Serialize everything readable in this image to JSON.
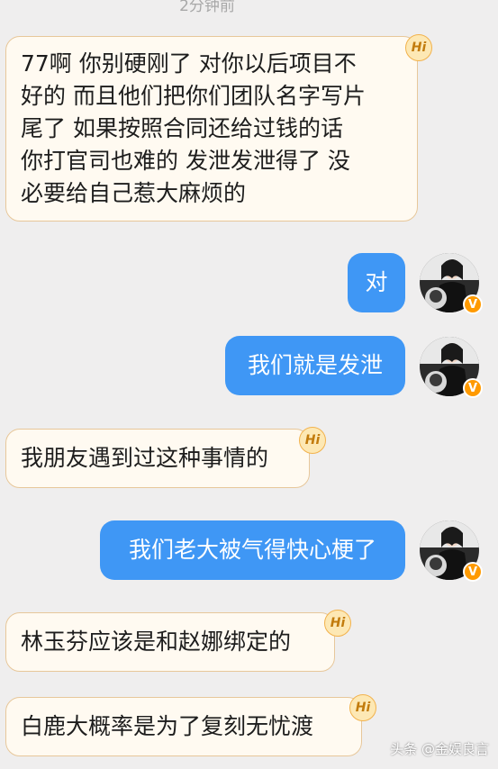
{
  "chat": {
    "timestamp": "2分钟前",
    "messages": [
      {
        "side": "left",
        "lines": [
          "77啊 你别硬刚了 对你以后项目不",
          "好的 而且他们把你们团队名字写片",
          "尾了 如果按照合同还给过钱的话",
          "你打官司也难的 发泄发泄得了 没",
          "必要给自己惹大麻烦的"
        ],
        "badge": "Hi"
      },
      {
        "side": "right",
        "text": "对"
      },
      {
        "side": "right",
        "text": "我们就是发泄"
      },
      {
        "side": "left",
        "text": "我朋友遇到过这种事情的",
        "badge": "Hi"
      },
      {
        "side": "right",
        "text": "我们老大被气得快心梗了"
      },
      {
        "side": "left",
        "text": "林玉芬应该是和赵娜绑定的",
        "badge": "Hi"
      },
      {
        "side": "left",
        "text": "白鹿大概率是为了复刻无忧渡",
        "badge": "Hi"
      }
    ],
    "avatar_badge": "V"
  },
  "watermark": "头条 @金娱良言",
  "colors": {
    "background": "#efeeee",
    "left_bubble": "#fffaf1",
    "left_border": "#e7c79a",
    "right_bubble": "#3f97f5",
    "badge": "#ff9a00"
  }
}
